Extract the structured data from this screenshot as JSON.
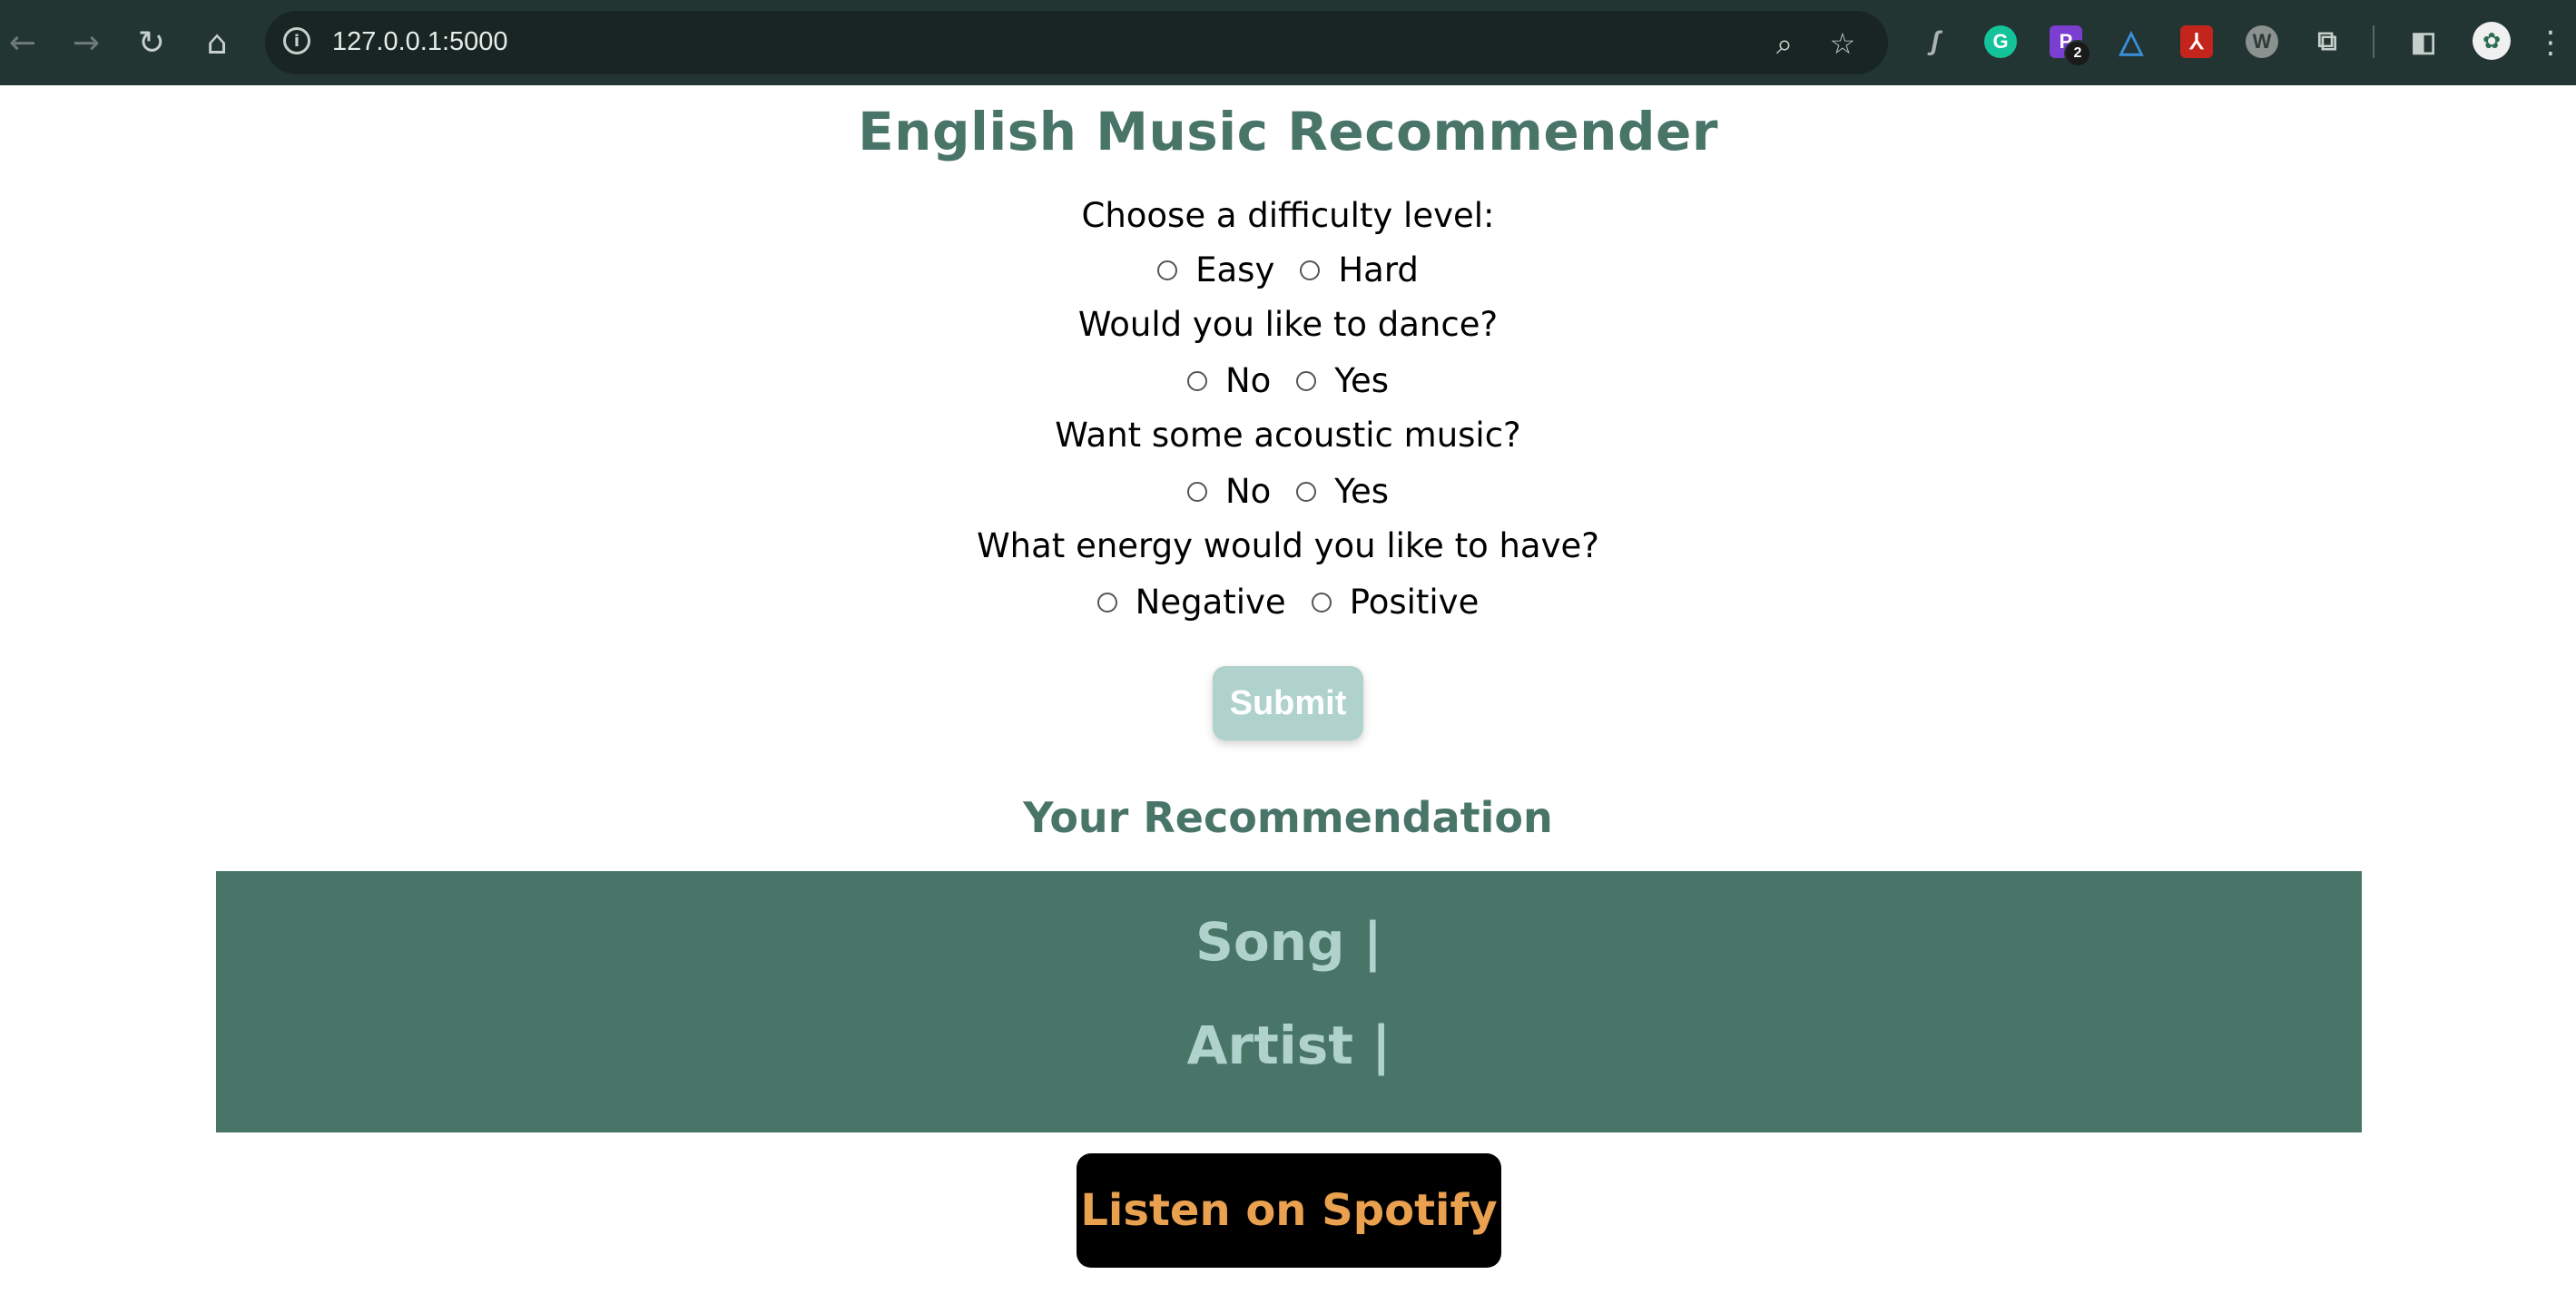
{
  "browser": {
    "url": "127.0.0.1:5000",
    "extension_badge": "2",
    "icons": [
      "back-icon",
      "forward-icon",
      "reload-icon",
      "home-icon",
      "info-icon",
      "zoom-icon",
      "star-icon",
      "extensions-icon",
      "side-panel-icon",
      "menu-icon"
    ]
  },
  "page": {
    "title": "English Music Recommender",
    "questions": [
      {
        "label": "Choose a difficulty level:",
        "options": [
          "Easy",
          "Hard"
        ]
      },
      {
        "label": "Would you like to dance?",
        "options": [
          "No",
          "Yes"
        ]
      },
      {
        "label": "Want some acoustic music?",
        "options": [
          "No",
          "Yes"
        ]
      },
      {
        "label": "What energy would you like to have?",
        "options": [
          "Negative",
          "Positive"
        ]
      }
    ],
    "submit_label": "Submit",
    "recommendation_heading": "Your Recommendation",
    "song_line": "Song |",
    "artist_line": "Artist |",
    "spotify_label": "Listen on Spotify"
  },
  "colors": {
    "accent": "#487568",
    "accent_light": "#b0d2cc",
    "spotify_text": "#e9a04f",
    "chrome_bg": "#233532"
  }
}
